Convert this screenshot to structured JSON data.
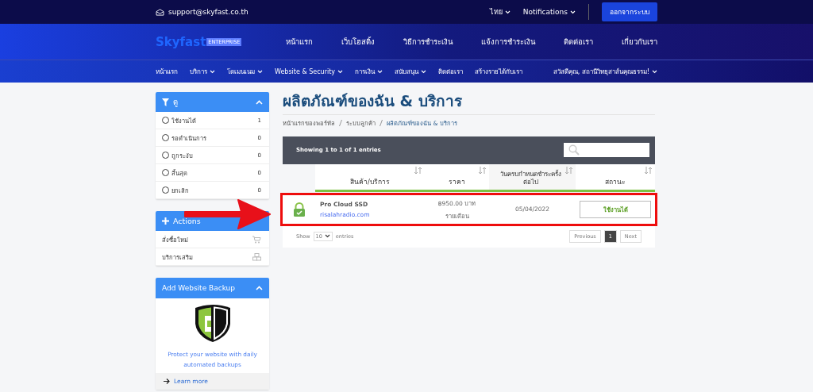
{
  "topbar": {
    "email": "support@skyfast.co.th",
    "language": "ไทย",
    "notifications": "Notifications",
    "logout": "ออกจากระบบ"
  },
  "header": {
    "logo": "Skyfast",
    "logo_badge": "ENTERPRISE",
    "links": [
      "หน้าแรก",
      "เว็บโฮสติ้ง",
      "วิธีการชำระเงิน",
      "แจ้งการชำระเงิน",
      "ติดต่อเรา",
      "เกี่ยวกับเรา"
    ]
  },
  "nav": {
    "items": [
      {
        "label": "หน้าแรก",
        "dropdown": false
      },
      {
        "label": "บริการ",
        "dropdown": true
      },
      {
        "label": "โดเมนเนม",
        "dropdown": true
      },
      {
        "label": "Website & Security",
        "dropdown": true
      },
      {
        "label": "การเงิน",
        "dropdown": true
      },
      {
        "label": "สนับสนุน",
        "dropdown": true
      },
      {
        "label": "ติดต่อเรา",
        "dropdown": false
      },
      {
        "label": "สร้างรายได้กับเรา",
        "dropdown": false
      }
    ],
    "user": "สวัสดีคุณ, สถานีวิทยุสาส์นคุณธรรม!"
  },
  "filter_panel": {
    "title": "ดู",
    "items": [
      {
        "label": "ใช้งานได้",
        "count": "1",
        "selected": false
      },
      {
        "label": "รอดำเนินการ",
        "count": "0",
        "selected": false
      },
      {
        "label": "ถูกระงับ",
        "count": "0",
        "selected": false
      },
      {
        "label": "สิ้นสุด",
        "count": "0",
        "selected": false
      },
      {
        "label": "ยกเลิก",
        "count": "0",
        "selected": false
      }
    ]
  },
  "actions_panel": {
    "title": "Actions",
    "items": [
      {
        "label": "สั่งซื้อใหม่",
        "kind": "cart"
      },
      {
        "label": "บริการเสริม",
        "kind": "cubes"
      }
    ]
  },
  "backup_panel": {
    "title": "Add Website Backup",
    "text": "Protect your website with daily automated backups",
    "link": "Learn more"
  },
  "page": {
    "title": "ผลิตภัณฑ์ของฉัน & บริการ",
    "breadcrumb": [
      "หน้าแรกของพอร์ทัล",
      "ระบบลูกค้า",
      "ผลิตภัณฑ์ของฉัน & บริการ"
    ]
  },
  "table": {
    "info": "Showing 1 to 1 of 1 entries",
    "columns": [
      "สินค้า/บริการ",
      "ราคา",
      "วันครบกำหนดชำระครั้งต่อไป",
      "สถานะ"
    ],
    "rows": [
      {
        "product": "Pro Cloud SSD",
        "domain": "risalahradio.com",
        "price": "฿950.00 บาท",
        "cycle": "รายเดือน",
        "due": "05/04/2022",
        "status": "ใช้งานได้"
      }
    ],
    "show_label": "Show",
    "page_size": "10",
    "entries_label": "entries",
    "previous": "Previous",
    "page": "1",
    "next": "Next"
  }
}
